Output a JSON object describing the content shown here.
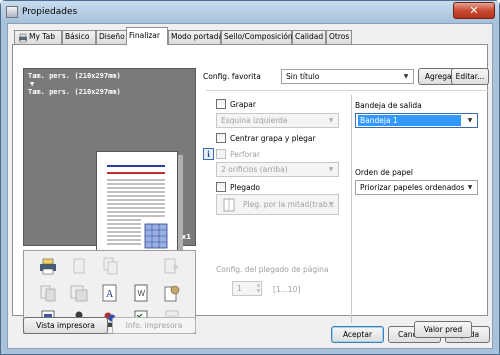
{
  "window": {
    "title": "Propiedades",
    "close_glyph": "✕"
  },
  "tabs": [
    {
      "label": "My Tab",
      "active": false
    },
    {
      "label": "Básico",
      "active": false
    },
    {
      "label": "Diseño",
      "active": false
    },
    {
      "label": "Finalizar",
      "active": true
    },
    {
      "label": "Modo portada",
      "active": false
    },
    {
      "label": "Sello/Composición",
      "active": false
    },
    {
      "label": "Calidad",
      "active": false
    },
    {
      "label": "Otros",
      "active": false
    }
  ],
  "preview": {
    "paper_line1": "Tam. pers. (210x297mm)",
    "arrow": "▼",
    "paper_line2": "Tam. pers. (210x297mm)",
    "copies": "x1"
  },
  "config": {
    "label": "Config. favorita",
    "value": "Sin título",
    "add_button": "Agregar...",
    "edit_button": "Editar..."
  },
  "finish": {
    "staple_label": "Grapar",
    "staple_value": "Esquina izquierda",
    "center_staple_label": "Centrar grapa y plegar",
    "punch_label": "Perforar",
    "punch_value": "2 orificios (arriba)",
    "fold_label": "Plegado",
    "fold_value": "Pleg. por la mitad(trab.c",
    "fold_config_label": "Config. del plegado de página",
    "fold_pages_value": "1",
    "fold_pages_range": "[1...10]"
  },
  "output": {
    "tray_label": "Bandeja de salida",
    "tray_value": "Bandeja 1",
    "order_label": "Orden de papel",
    "order_value": "Priorizar papeles ordenados"
  },
  "buttons": {
    "printer_view": "Vista impresora",
    "printer_info": "Info. impresora",
    "default": "Valor pred",
    "accept": "Aceptar",
    "cancel": "Cancelar",
    "help": "Ayuda"
  },
  "icons": {
    "tab_icon": "printer-icon",
    "info_icon": "info-icon",
    "info_glyph": "i",
    "dropdown_glyph": "▼",
    "spin_up": "▲",
    "spin_down": "▼"
  }
}
